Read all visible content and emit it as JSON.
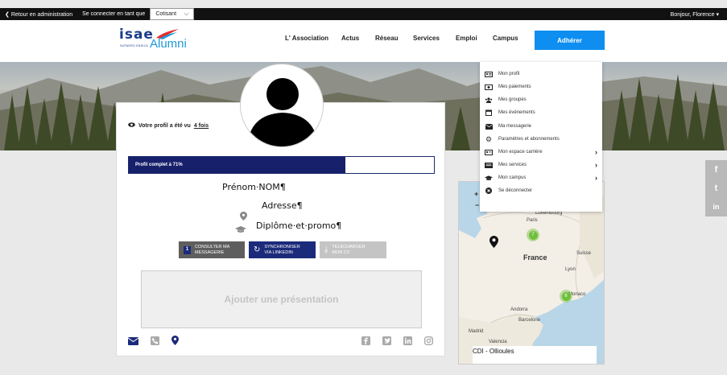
{
  "topbar": {
    "back_label": "Retour en administration",
    "connect_as_label": "Se connecter en tant que",
    "role_value": "Cotisant",
    "greeting": "Bonjour, Florence"
  },
  "nav": {
    "logo_isae": "isae",
    "logo_sub": "SUPAERO ENSICA",
    "logo_alumni": "Alumni",
    "items": [
      {
        "label": "L' Association"
      },
      {
        "label": "Actus"
      },
      {
        "label": "Réseau"
      },
      {
        "label": "Services"
      },
      {
        "label": "Emploi"
      },
      {
        "label": "Campus"
      }
    ],
    "cta_label": "Adhérer"
  },
  "profile": {
    "views_text": "Votre profil a été vu",
    "views_count": "4 fois",
    "progress_label": "Profil complet à 71%",
    "progress_value": 0.71,
    "name": "Prénom·NOM¶",
    "address": "Adresse¶",
    "diploma": "Diplôme·et·promo¶",
    "buttons": {
      "messaging_line1": "CONSULTER MA",
      "messaging_line2": "MESSAGERIE",
      "messaging_badge": "1",
      "linkedin_line1": "SYNCHRONISER",
      "linkedin_line2": "VIA LINKEDIN",
      "cv_line1": "TÉLÉCHARGER",
      "cv_line2": "MON CV"
    },
    "presentation_placeholder": "Ajouter une présentation"
  },
  "dropdown": {
    "items": [
      {
        "label": "Mon profil",
        "icon": "id-card-icon"
      },
      {
        "label": "Mes paiements",
        "icon": "money-icon"
      },
      {
        "label": "Mes groupes",
        "icon": "users-icon"
      },
      {
        "label": "Mes événements",
        "icon": "calendar-icon"
      },
      {
        "label": "Ma messagerie",
        "icon": "envelope-icon"
      },
      {
        "label": "Paramètres et abonnements",
        "icon": "gear-icon"
      },
      {
        "label": "Mon espace carrière",
        "icon": "briefcase-icon",
        "has_submenu": true
      },
      {
        "label": "Mes services",
        "icon": "services-icon",
        "has_submenu": true
      },
      {
        "label": "Mon campus",
        "icon": "graduation-cap-icon",
        "has_submenu": true
      },
      {
        "label": "Se déconnecter",
        "icon": "logout-icon"
      }
    ]
  },
  "map": {
    "labels": {
      "country": "France",
      "luxembourg": "Luxembourg",
      "paris": "Paris",
      "suisse": "Suisse",
      "lyon": "Lyon",
      "monaco": "Monaco",
      "andorra": "Andorra",
      "barcelona": "Barcelone",
      "madrid": "Madrid",
      "valencia": "Valencia"
    },
    "cluster_paris": "7",
    "cluster_south": "6",
    "zoom_in": "+",
    "zoom_out": "−",
    "caption": "CDI - Ollioules"
  },
  "social": {
    "facebook": "f",
    "twitter": "t",
    "linkedin": "in"
  },
  "colors": {
    "accent": "#0d8ef0",
    "navy": "#17206b"
  }
}
